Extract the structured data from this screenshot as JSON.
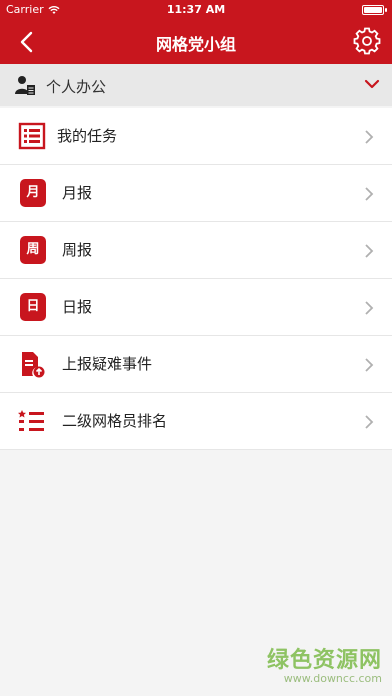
{
  "status_bar": {
    "carrier": "Carrier",
    "time": "11:37 AM",
    "battery_level": 1.0
  },
  "nav": {
    "title": "网格党小组",
    "back_icon": "chevron-left-icon",
    "settings_icon": "gear-icon"
  },
  "section": {
    "title": "个人办公",
    "icon": "person-document-icon",
    "toggle_icon": "chevron-down-icon"
  },
  "menu": {
    "items": [
      {
        "label": "我的任务",
        "icon": "task-list-icon"
      },
      {
        "label": "月报",
        "icon": "calendar-month-icon",
        "badge": "月"
      },
      {
        "label": "周报",
        "icon": "calendar-week-icon",
        "badge": "周"
      },
      {
        "label": "日报",
        "icon": "calendar-day-icon",
        "badge": "日"
      },
      {
        "label": "上报疑难事件",
        "icon": "report-upload-icon"
      },
      {
        "label": "二级网格员排名",
        "icon": "ranking-list-icon"
      }
    ]
  },
  "watermark": {
    "main": "绿色资源网",
    "url": "www.downcc.com"
  },
  "colors": {
    "brand": "#c8161e",
    "background": "#f4f4f4",
    "section_bg": "#e8e8e8",
    "watermark": "#7dbb4a"
  }
}
